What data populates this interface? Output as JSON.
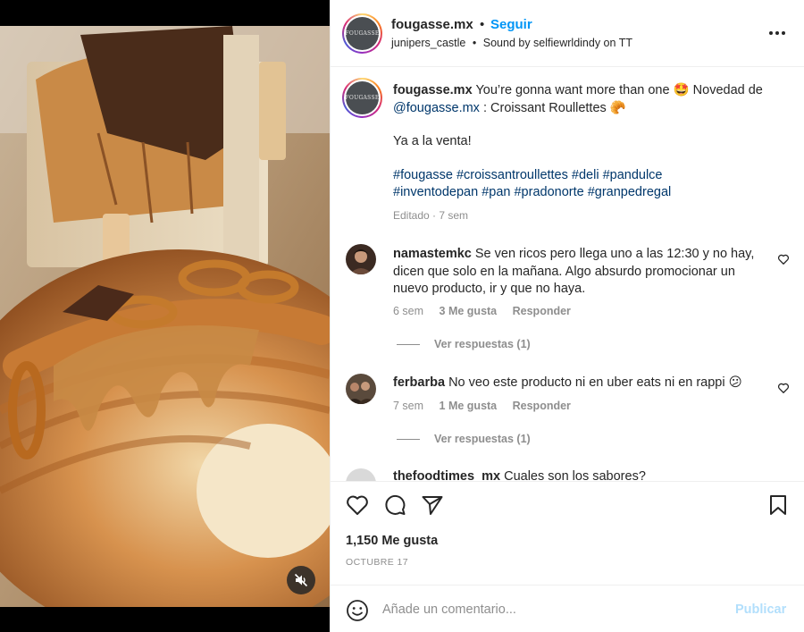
{
  "media": {
    "mute_icon": "speaker-muted-icon"
  },
  "post": {
    "account": {
      "username": "fougasse.mx",
      "avatar_text": "FOUGASSE",
      "follow_label": "Seguir",
      "separator": "•",
      "location": "junipers_castle",
      "audio": "Sound by selfiewrldindy on TT"
    },
    "caption": {
      "username": "fougasse.mx",
      "text_1": "You’re gonna want more than one 🤩 Novedad de",
      "mention": "@fougasse.mx",
      "text_2": ": Croissant Roullettes 🥐",
      "line_2": "Ya a la venta!",
      "hashtags": [
        "#fougasse",
        "#croissantroullettes",
        "#deli",
        "#pandulce",
        "#inventodepan",
        "#pan",
        "#pradonorte",
        "#granpedregal"
      ],
      "meta": "Editado · 7 sem"
    },
    "comments": [
      {
        "username": "namastemkc",
        "text": "Se ven ricos pero llega uno a las 12:30 y no hay, dicen que solo en la mañana. Algo absurdo promocionar un nuevo producto, ir y que no haya.",
        "time": "6 sem",
        "likes": "3 Me gusta",
        "reply_label": "Responder",
        "view_replies": "Ver respuestas (1)"
      },
      {
        "username": "ferbarba",
        "text": "No veo este producto ni en uber eats ni en rappi 😕",
        "time": "7 sem",
        "likes": "1 Me gusta",
        "reply_label": "Responder",
        "view_replies": "Ver respuestas (1)"
      },
      {
        "username": "thefoodtimes_mx",
        "text": "Cuales son los sabores?"
      }
    ],
    "likes_count": "1,150 Me gusta",
    "date": "OCTUBRE 17",
    "comment_box": {
      "placeholder": "Añade un comentario...",
      "post_label": "Publicar"
    },
    "colors": {
      "accent": "#0095f6",
      "post_disabled": "#b2dffc",
      "muted_text": "#8e8e8e",
      "link": "#00376b"
    }
  }
}
